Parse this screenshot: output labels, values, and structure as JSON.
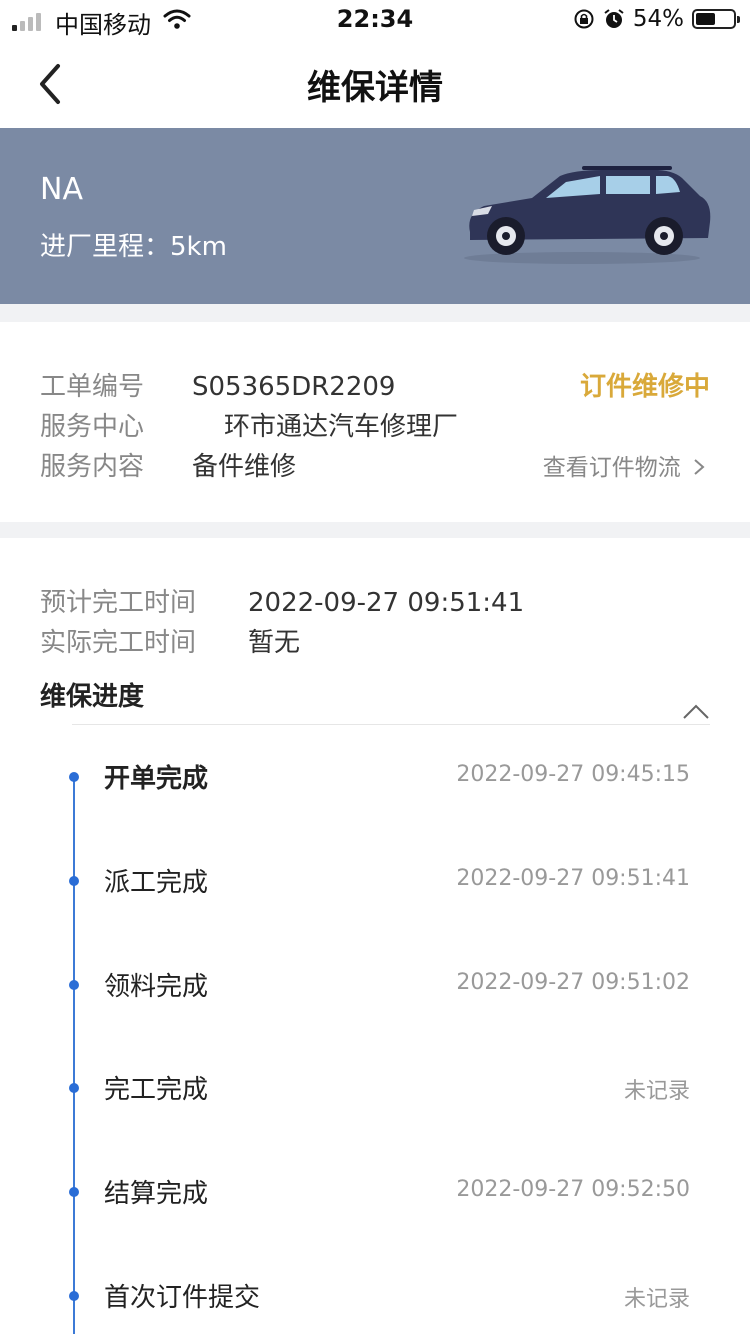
{
  "status_bar": {
    "carrier": "中国移动",
    "time": "22:34",
    "battery": "54%",
    "battery_level": 0.54
  },
  "nav": {
    "title": "维保详情"
  },
  "vehicle": {
    "plate": "NA",
    "mileage": "进厂里程：5km"
  },
  "order": {
    "number_label": "工单编号",
    "number_value": "S05365DR2209",
    "status": "订件维修中",
    "center_label": "服务中心",
    "center_value": "环市通达汽车修理厂",
    "content_label": "服务内容",
    "content_value": "备件维修",
    "logistics_link": "查看订件物流"
  },
  "completion": {
    "expected_label": "预计完工时间",
    "expected_value": "2022-09-27 09:51:41",
    "actual_label": "实际完工时间",
    "actual_value": "暂无",
    "section_title": "维保进度"
  },
  "steps": [
    {
      "name": "开单完成",
      "time": "2022-09-27 09:45:15",
      "bold": true
    },
    {
      "name": "派工完成",
      "time": "2022-09-27 09:51:41"
    },
    {
      "name": "领料完成",
      "time": "2022-09-27 09:51:02"
    },
    {
      "name": "完工完成",
      "time": "未记录"
    },
    {
      "name": "结算完成",
      "time": "2022-09-27 09:52:50"
    },
    {
      "name": "首次订件提交",
      "time": "未记录"
    }
  ]
}
